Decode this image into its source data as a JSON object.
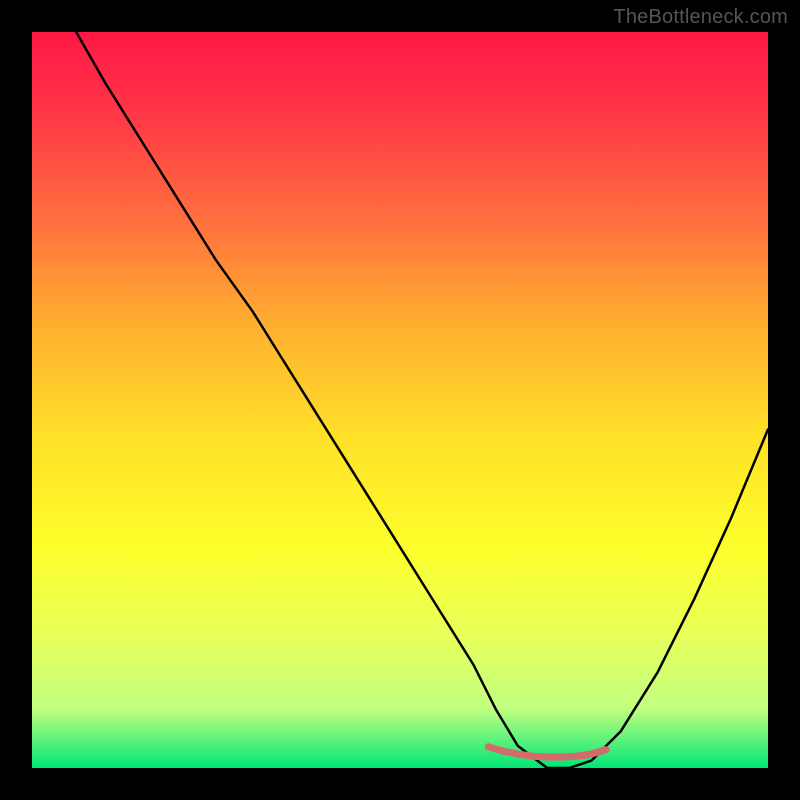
{
  "watermark": "TheBottleneck.com",
  "chart_data": {
    "type": "line",
    "title": "",
    "xlabel": "",
    "ylabel": "",
    "xlim": [
      0,
      100
    ],
    "ylim": [
      0,
      100
    ],
    "gradient_stops": [
      {
        "offset": 0,
        "color": "#ff1744"
      },
      {
        "offset": 10,
        "color": "#ff3348"
      },
      {
        "offset": 25,
        "color": "#ff6d3f"
      },
      {
        "offset": 40,
        "color": "#ffb030"
      },
      {
        "offset": 55,
        "color": "#ffe028"
      },
      {
        "offset": 70,
        "color": "#fcff2a"
      },
      {
        "offset": 82,
        "color": "#e8ff5a"
      },
      {
        "offset": 92,
        "color": "#c0ff80"
      },
      {
        "offset": 100,
        "color": "#00e676"
      }
    ],
    "series": [
      {
        "name": "bottleneck-curve",
        "color": "#000000",
        "stroke_width": 2.5,
        "x": [
          6,
          10,
          15,
          20,
          25,
          30,
          35,
          40,
          45,
          50,
          55,
          60,
          63,
          66,
          70,
          73,
          76,
          80,
          85,
          90,
          95,
          100
        ],
        "values": [
          100,
          93,
          85,
          77,
          69,
          62,
          54,
          46,
          38,
          30,
          22,
          14,
          8,
          3,
          0,
          0,
          1,
          5,
          13,
          23,
          34,
          46
        ]
      },
      {
        "name": "optimal-range-marker",
        "color": "#d46a6a",
        "stroke_width": 7,
        "x": [
          62,
          64,
          66,
          68,
          70,
          72,
          74,
          76,
          78
        ],
        "values": [
          2.9,
          2.3,
          1.9,
          1.6,
          1.5,
          1.5,
          1.6,
          1.9,
          2.5
        ]
      }
    ]
  }
}
